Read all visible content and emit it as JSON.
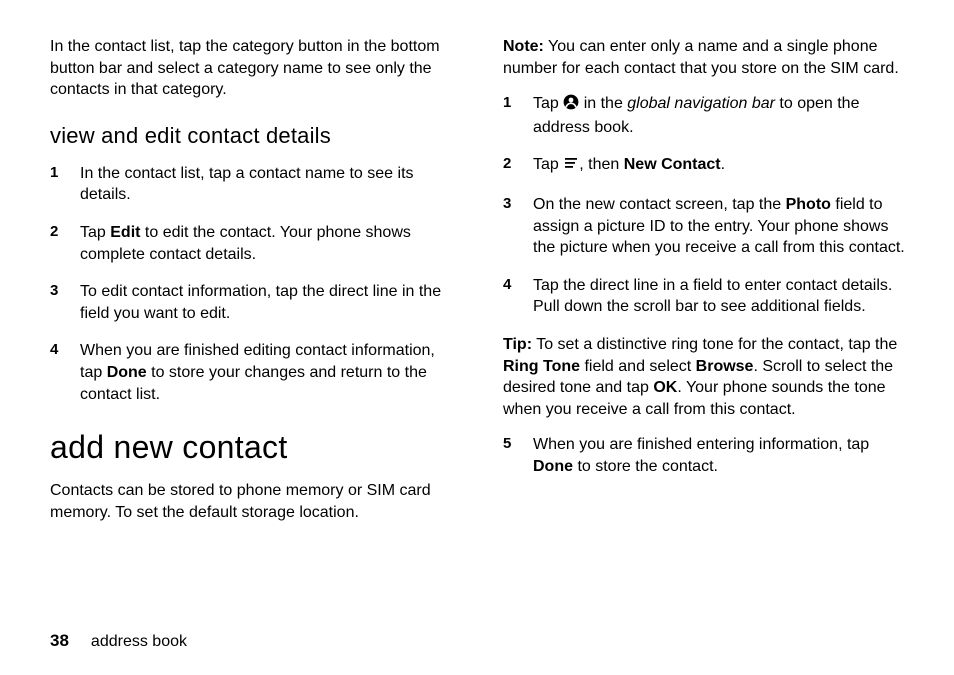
{
  "left": {
    "intro": "In the contact list, tap the category button in the bottom button bar and select a category name to see only the contacts in that category.",
    "subhead": "view and edit contact details",
    "steps": [
      {
        "n": "1",
        "pre": "In the contact list, tap a contact name to see its details."
      },
      {
        "n": "2",
        "pre": "Tap ",
        "bold1": "Edit",
        "post": " to edit the contact. Your phone shows complete contact details."
      },
      {
        "n": "3",
        "pre": "To edit contact information, tap the direct line in the field you want to edit."
      },
      {
        "n": "4",
        "pre": "When you are finished editing contact information, tap ",
        "bold1": "Done",
        "post": " to store your changes and return to the contact list."
      }
    ],
    "h1": "add new contact",
    "h1_body": "Contacts can be stored to phone memory or SIM card memory. To set the default storage location."
  },
  "right": {
    "noteLabel": "Note:",
    "noteBody": " You can enter only a name and a single phone number for each contact that you store on the SIM card.",
    "steps12": {
      "s1": {
        "n": "1",
        "pre": "Tap ",
        "iconName": "contact-icon",
        "mid": " in the ",
        "ital": "global navigation bar",
        "post": " to open the address book."
      },
      "s2": {
        "n": "2",
        "pre": "Tap ",
        "iconName": "menu-icon",
        "mid": ", then ",
        "bold": "New Contact",
        "post": "."
      }
    },
    "s3": {
      "n": "3",
      "pre": "On the new contact screen, tap the ",
      "bold": "Photo",
      "post": " field to assign a picture ID to the entry. Your phone shows the picture when you receive a call from this contact."
    },
    "s4": {
      "n": "4",
      "pre": "Tap the direct line in a field to enter contact details. Pull down the scroll bar to see additional fields."
    },
    "tipLabel": "Tip:",
    "tip_pre": " To set a distinctive ring tone for the contact, tap the ",
    "tip_b1": "Ring Tone",
    "tip_mid1": " field and select ",
    "tip_b2": "Browse",
    "tip_mid2": ". Scroll to select the desired tone and tap ",
    "tip_b3": "OK",
    "tip_post": ". Your phone sounds the tone when you receive a call from this contact.",
    "s5": {
      "n": "5",
      "pre": "When you are finished entering information, tap ",
      "bold": "Done",
      "post": " to store the contact."
    }
  },
  "footer": {
    "page": "38",
    "section": "address book"
  }
}
